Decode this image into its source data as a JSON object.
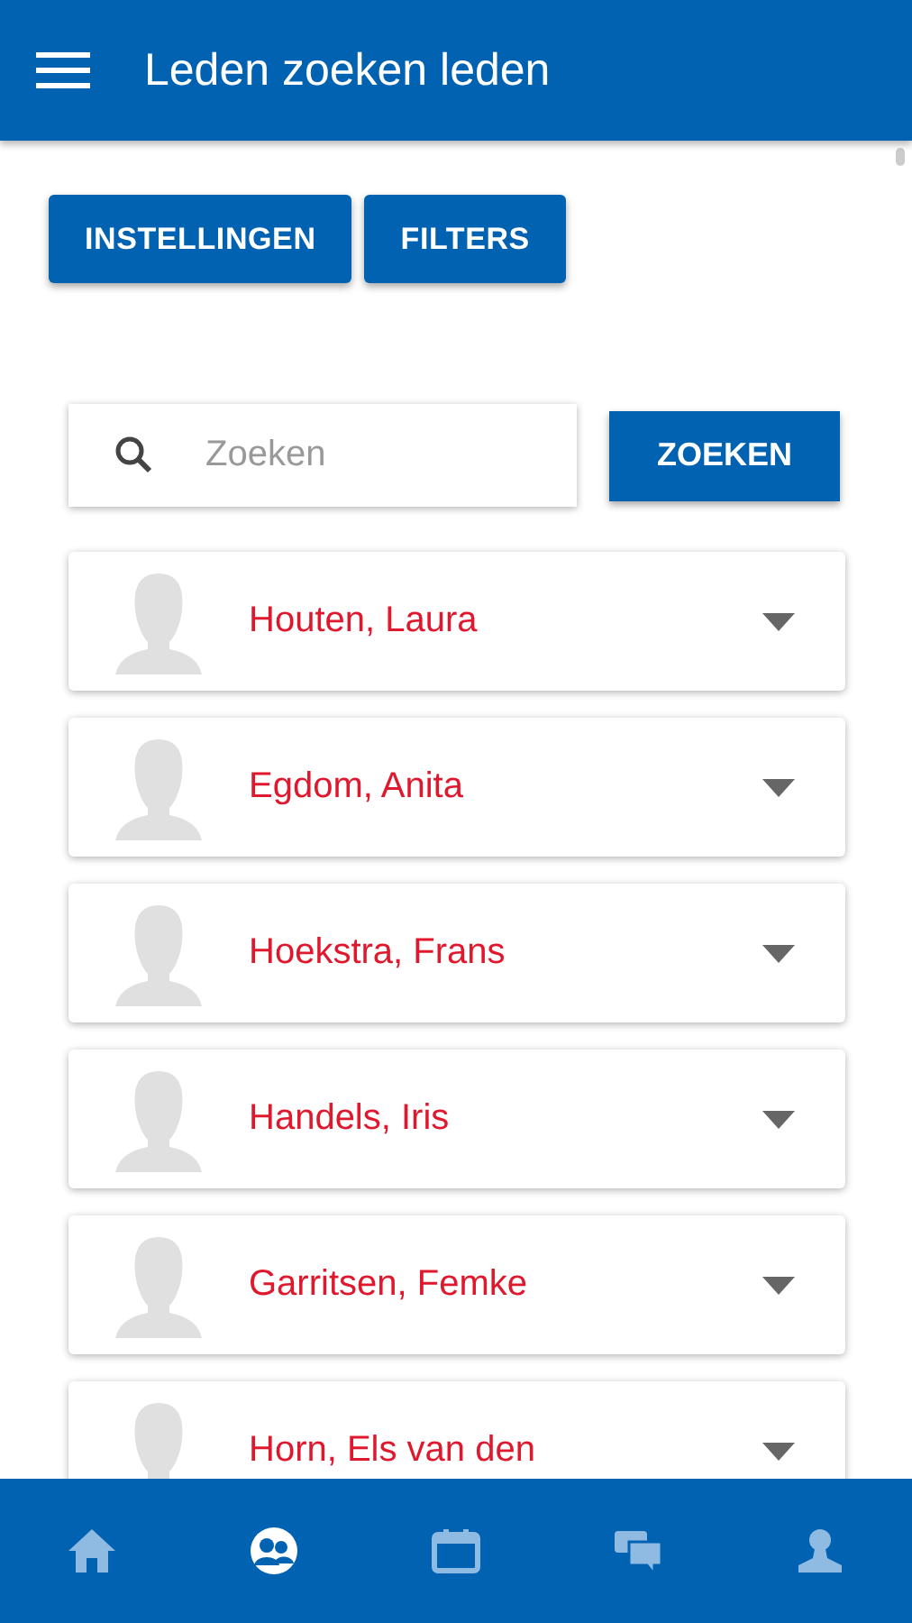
{
  "app_bar": {
    "title": "Leden zoeken leden"
  },
  "actions": [
    "INSTELLINGEN",
    "FILTERS"
  ],
  "search": {
    "placeholder": "Zoeken",
    "button": "ZOEKEN"
  },
  "members": [
    {
      "name": "Houten, Laura"
    },
    {
      "name": "Egdom, Anita"
    },
    {
      "name": "Hoekstra, Frans"
    },
    {
      "name": "Handels, Iris"
    },
    {
      "name": "Garritsen, Femke"
    },
    {
      "name": "Horn, Els van den"
    }
  ],
  "bottom_nav": [
    {
      "kind": "home",
      "selected": false
    },
    {
      "kind": "members",
      "selected": true
    },
    {
      "kind": "calendar",
      "selected": false
    },
    {
      "kind": "chat",
      "selected": false
    },
    {
      "kind": "profile",
      "selected": false
    }
  ]
}
